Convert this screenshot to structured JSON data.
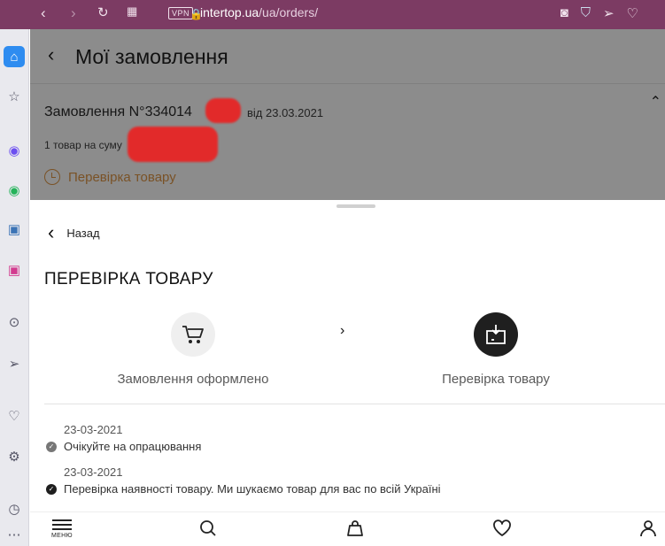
{
  "browser": {
    "url_host": "intertop.ua",
    "url_path": "/ua/orders/",
    "vpn_label": "VPN",
    "colors": {
      "toolbar": "#7c3b63"
    }
  },
  "sidebar": {
    "icons": [
      "home-icon",
      "star-icon",
      "messenger-icon",
      "whatsapp-icon",
      "vk-icon",
      "instagram-icon",
      "player-icon",
      "send-icon",
      "heart-icon",
      "settings-icon",
      "history-icon",
      "more-icon"
    ]
  },
  "page": {
    "title": "Мої замовлення",
    "order_title": "Замовлення N°334014",
    "order_date": "від 23.03.2021",
    "items_line": "1 товар на суму",
    "status": "Перевірка товару"
  },
  "sheet": {
    "back_label": "Назад",
    "title": "ПЕРЕВІРКА ТОВАРУ",
    "steps": [
      {
        "label": "Замовлення оформлено",
        "icon": "cart-icon",
        "state": "inactive"
      },
      {
        "label": "Перевірка товару",
        "icon": "box-check-icon",
        "state": "active"
      }
    ],
    "history": [
      {
        "date": "23-03-2021",
        "text": "Очікуйте на опрацювання"
      },
      {
        "date": "23-03-2021",
        "text": "Перевірка наявності товару. Ми шукаємо товар для вас по всій Україні"
      }
    ]
  },
  "bottom_nav": {
    "menu_label": "МЕНЮ",
    "items": [
      "menu-icon",
      "search-icon",
      "bag-icon",
      "heart-icon",
      "user-icon"
    ]
  }
}
